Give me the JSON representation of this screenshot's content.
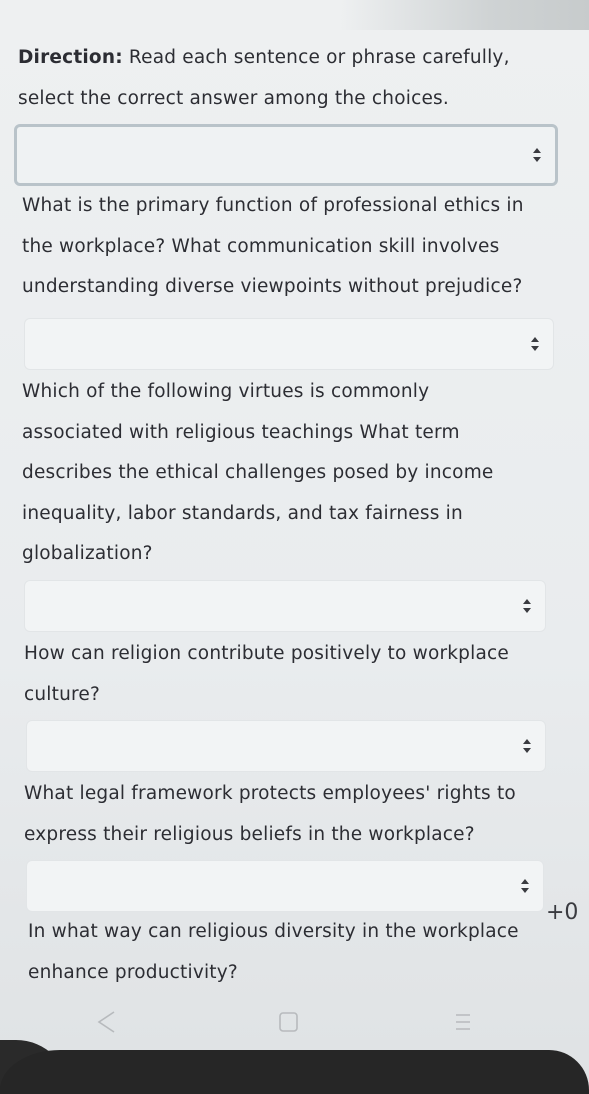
{
  "direction": {
    "label": "Direction:",
    "text": "Read each sentence or phrase carefully, select the correct answer among the choices."
  },
  "questions": [
    {
      "text": "What is the primary function of professional ethics in the workplace? What communication skill involves understanding diverse viewpoints without prejudice?"
    },
    {
      "text": "Which of the following virtues is commonly associated with religious teachings What term describes the ethical challenges posed by income inequality, labor standards, and tax fairness in globalization?"
    },
    {
      "text": "How can religion contribute positively to workplace culture?"
    },
    {
      "text": "What legal framework protects employees' rights to express their religious beliefs in the workplace?"
    },
    {
      "text": "In what way can religious diversity in the workplace enhance productivity?"
    }
  ],
  "selects": [
    {
      "value": ""
    },
    {
      "value": ""
    },
    {
      "value": ""
    },
    {
      "value": ""
    },
    {
      "value": ""
    }
  ],
  "side_badge": "+0",
  "icons": {
    "select_arrows": "up-down-arrows-icon",
    "nav_back": "back-triangle-icon",
    "nav_home": "home-square-icon",
    "nav_recent": "recent-apps-icon"
  },
  "colors": {
    "background": "#eceff0",
    "text": "#2c2d33",
    "select_bg": "#f2f4f5",
    "select_focus_border": "#b9c3c9",
    "bottom_bar": "#262626"
  }
}
